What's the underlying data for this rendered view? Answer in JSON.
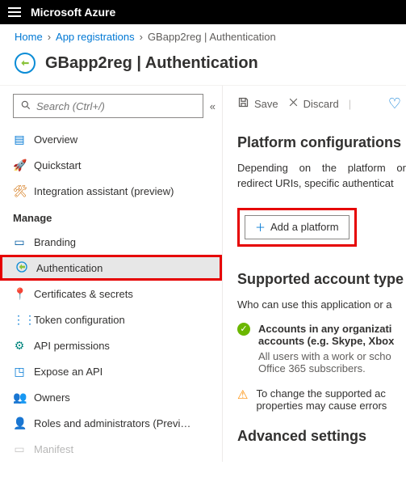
{
  "brand": "Microsoft Azure",
  "breadcrumb": {
    "home": "Home",
    "apps": "App registrations",
    "current": "GBapp2reg | Authentication"
  },
  "page_title": "GBapp2reg | Authentication",
  "search": {
    "placeholder": "Search (Ctrl+/)"
  },
  "nav": {
    "overview": "Overview",
    "quickstart": "Quickstart",
    "integration": "Integration assistant (preview)",
    "manage_heading": "Manage",
    "branding": "Branding",
    "authentication": "Authentication",
    "certificates": "Certificates & secrets",
    "token": "Token configuration",
    "api_permissions": "API permissions",
    "expose": "Expose an API",
    "owners": "Owners",
    "roles": "Roles and administrators (Previ…",
    "manifest": "Manifest"
  },
  "toolbar": {
    "save": "Save",
    "discard": "Discard"
  },
  "main": {
    "platform_heading": "Platform configurations",
    "platform_para": "Depending on the platform or redirect URIs, specific authenticat",
    "add_platform": "Add a platform",
    "supported_heading": "Supported account type",
    "who": "Who can use this application or a",
    "accounts_bold": "Accounts in any organizati accounts (e.g. Skype, Xbox",
    "accounts_sub": "All users with a work or scho Office 365 subscribers.",
    "warn_text": "To change the supported ac properties may cause errors",
    "advanced_heading": "Advanced settings"
  }
}
